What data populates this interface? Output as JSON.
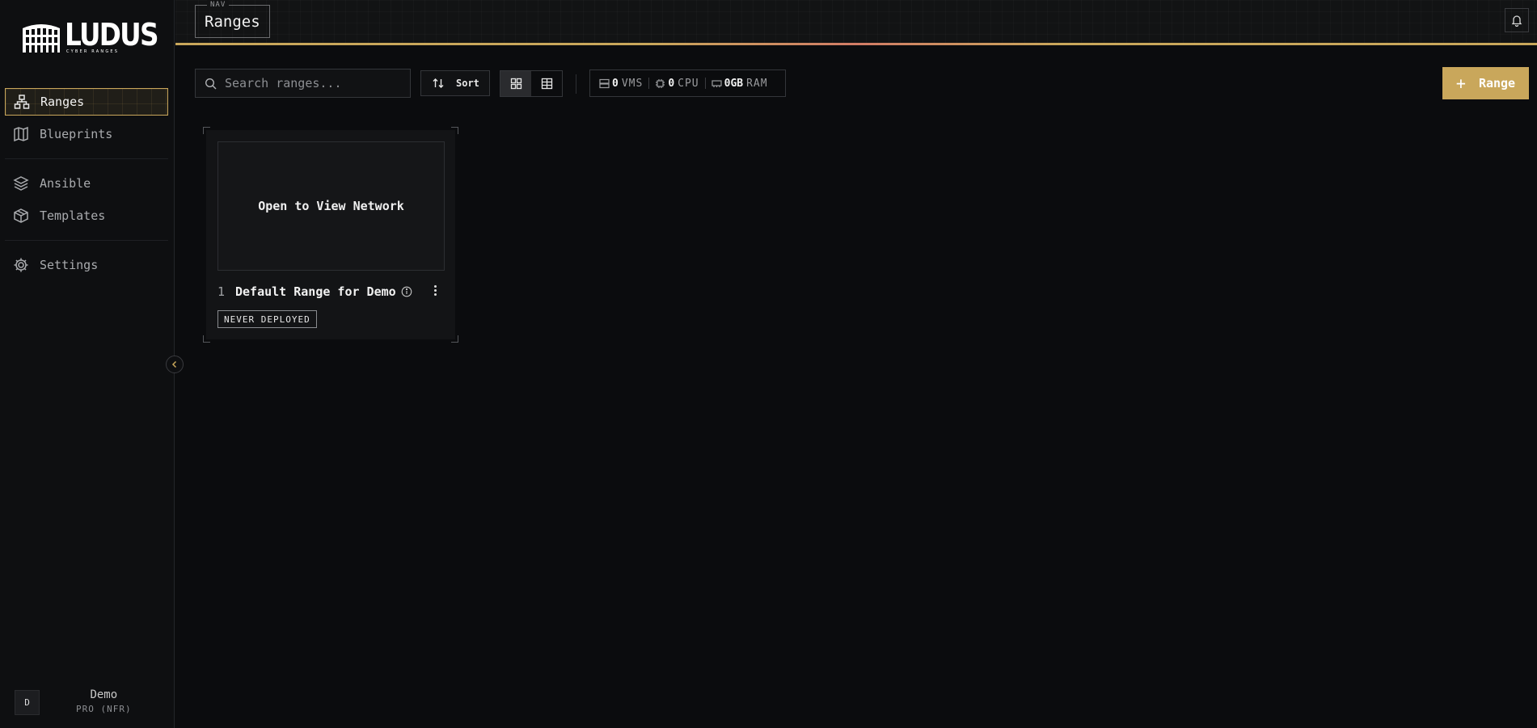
{
  "brand": {
    "name": "LUDUS",
    "tagline": "CYBER RANGES"
  },
  "sidebar": {
    "items": [
      {
        "label": "Ranges",
        "icon": "network-icon",
        "active": true
      },
      {
        "label": "Blueprints",
        "icon": "map-icon"
      },
      {
        "label": "Ansible",
        "icon": "layers-icon"
      },
      {
        "label": "Templates",
        "icon": "box-icon"
      },
      {
        "label": "Settings",
        "icon": "gear-icon"
      }
    ],
    "user": {
      "initial": "D",
      "name": "Demo",
      "plan": "PRO (NFR)"
    }
  },
  "header": {
    "nav_label": "NAV",
    "title": "Ranges",
    "accent_color": "#c9a75b"
  },
  "toolbar": {
    "search_placeholder": "Search ranges...",
    "sort_label": "Sort",
    "stats": {
      "vms_value": "0",
      "vms_unit": "VMS",
      "cpu_value": "0",
      "cpu_unit": "CPU",
      "ram_value": "0GB",
      "ram_unit": "RAM"
    },
    "add_label": "Range"
  },
  "ranges": [
    {
      "number": "1",
      "name": "Default Range for Demo",
      "preview_text": "Open to View Network",
      "status": "NEVER DEPLOYED"
    }
  ]
}
